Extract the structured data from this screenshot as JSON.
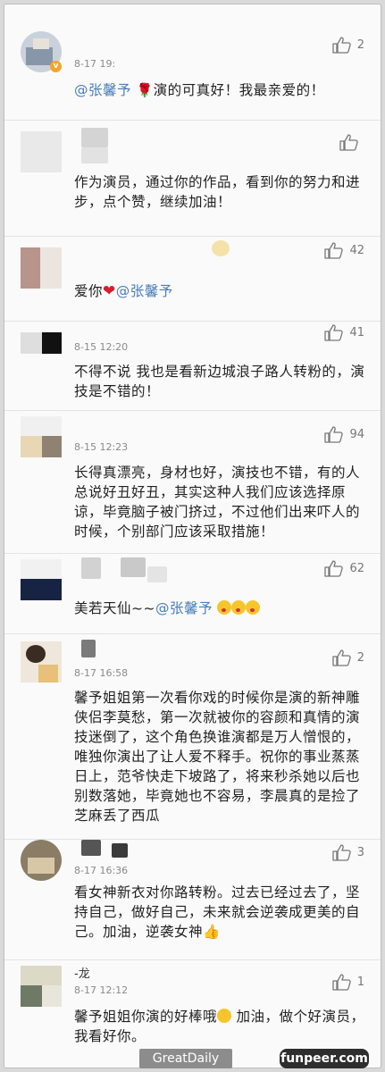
{
  "comments": [
    {
      "time": "8-17 19:",
      "likes": "2",
      "mention": "@张馨予",
      "rose": "🌹",
      "text": "演的可真好！我最亲爱的！",
      "verified_badge": "v"
    },
    {
      "likes": "",
      "text": "作为演员，通过你的作品，看到你的努力和进步，点个赞，继续加油！"
    },
    {
      "likes": "42",
      "text_before": "爱你",
      "heart": "❤",
      "mention": "@张馨予"
    },
    {
      "time": "8-15 12:20",
      "likes": "41",
      "text": "不得不说 我也是看新边城浪子路人转粉的，演技是不错的！"
    },
    {
      "time": "8-15 12:23",
      "likes": "94",
      "text": "长得真漂亮，身材也好，演技也不错，有的人总说好丑好丑，其实这种人我们应该选择原谅，毕竟脑子被门挤过，不过他们出来吓人的时候，个别部门应该采取措施！"
    },
    {
      "likes": "62",
      "text_before": "美若天仙~~",
      "mention": "@张馨予"
    },
    {
      "time": "8-17 16:58",
      "likes": "2",
      "text": "馨予姐姐第一次看你戏的时候你是演的新神雕侠侣李莫愁，第一次就被你的容颜和真情的演技迷倒了，这个角色换谁演都是万人憎恨的，唯独你演出了让人爱不释手。祝你的事业蒸蒸日上，范爷快走下坡路了，将来秒杀她以后也别数落她，毕竟她也不容易，李晨真的是捡了芝麻丢了西瓜"
    },
    {
      "time": "8-17 16:36",
      "likes": "3",
      "text": "看女神新衣对你路转粉。过去已经过去了，坚持自己，做好自己，未来就会逆袭成更美的自己。加油，逆袭女神👍"
    },
    {
      "name_fragment": "-龙",
      "time": "8-17 12:12",
      "likes": "1",
      "text_before": "馨予姐姐你演的好棒哦",
      "text_after": " 加油，做个好演员，我看好你。"
    }
  ],
  "watermarks": {
    "left": "GreatDaily",
    "right": "funpeer.com"
  },
  "colors": {
    "mention": "#4a7db8",
    "text": "#222222",
    "meta": "#8a8a8a",
    "verified": "#f3a62b"
  },
  "icons": {
    "like": "thumbs-up-icon",
    "verified": "verified-badge-icon"
  }
}
